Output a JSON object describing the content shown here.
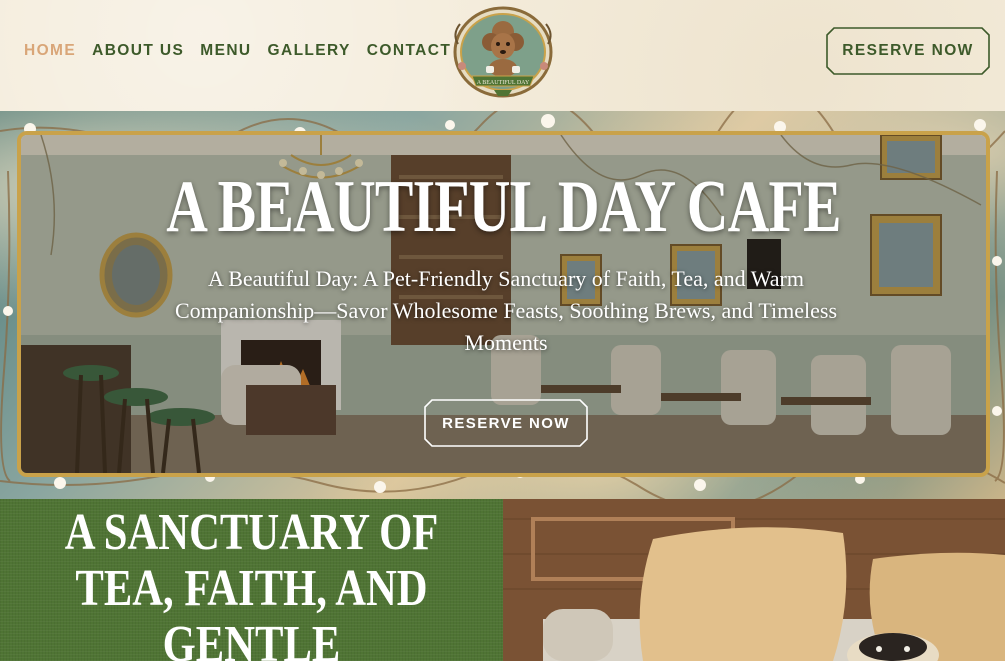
{
  "nav": {
    "items": [
      {
        "label": "HOME",
        "active": true
      },
      {
        "label": "ABOUT US",
        "active": false
      },
      {
        "label": "MENU",
        "active": false
      },
      {
        "label": "GALLERY",
        "active": false
      },
      {
        "label": "CONTACT",
        "active": false
      }
    ]
  },
  "logo": {
    "ribbon_text": "A BEAUTIFUL DAY",
    "icon": "poodle-logo"
  },
  "header": {
    "reserve_label": "RESERVE NOW"
  },
  "hero": {
    "title": "A BEAUTIFUL DAY CAFE",
    "subtitle": "A Beautiful Day: A Pet-Friendly Sanctuary of Faith, Tea, and Warm Companionship—Savor Wholesome Feasts, Soothing Brews, and Timeless Moments",
    "reserve_label": "RESERVE NOW"
  },
  "section": {
    "title": "A SANCTUARY OF\nTEA, FAITH, AND\nGENTLE"
  },
  "colors": {
    "green": "#3d5a2a",
    "active_nav": "#d9a678",
    "gold_frame": "#c9a24a",
    "panel_green": "#4f7434",
    "cream": "#f4ecdb"
  }
}
